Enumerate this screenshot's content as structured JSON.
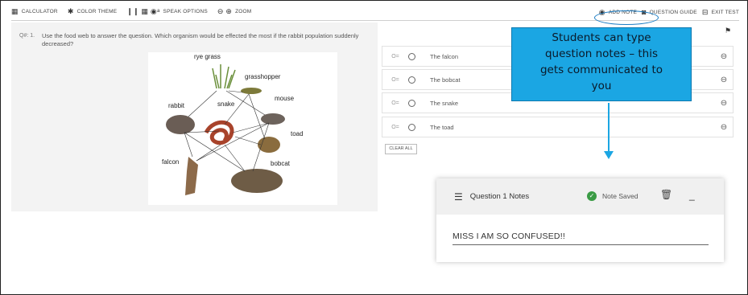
{
  "toolbar": {
    "left": [
      {
        "icon": "calculator-icon",
        "glyph": "▦",
        "label": "CALCULATOR"
      },
      {
        "icon": "palette-icon",
        "glyph": "✱",
        "label": "COLOR THEME"
      },
      {
        "icon": "speak-icon",
        "glyph": "❙❙ ▦ ◉ᵃ",
        "label": "SPEAK OPTIONS"
      },
      {
        "icon": "zoom-icon",
        "glyph": "⊖ ⊕",
        "label": "ZOOM"
      }
    ],
    "right": [
      {
        "icon": "add-note-icon",
        "glyph": "◉",
        "label": "ADD NOTE"
      },
      {
        "icon": "question-guide-icon",
        "glyph": "◙",
        "label": "QUESTION GUIDE"
      },
      {
        "icon": "exit-icon",
        "glyph": "⊟",
        "label": "EXIT TEST"
      }
    ]
  },
  "question": {
    "number": "Q#: 1.",
    "text": "Use the food web to answer the question.  Which organism would be effected the most if the rabbit population suddenly decreased?"
  },
  "foodweb": {
    "labels": [
      "rye grass",
      "grasshopper",
      "rabbit",
      "snake",
      "mouse",
      "toad",
      "falcon",
      "bobcat"
    ]
  },
  "answers": [
    {
      "eliminate": "O=",
      "text": "The falcon",
      "close": "⊖"
    },
    {
      "eliminate": "O=",
      "text": "The bobcat",
      "close": "⊖"
    },
    {
      "eliminate": "O=",
      "text": "The snake",
      "close": "⊖"
    },
    {
      "eliminate": "O=",
      "text": "The toad",
      "close": "⊖"
    }
  ],
  "clear_all": "CLEAR ALL",
  "callout": {
    "lines": [
      "Students can type",
      "question notes – this",
      "gets communicated to",
      "you"
    ],
    "color": "#1ba6e3"
  },
  "notes": {
    "title": "Question 1 Notes",
    "status": "Note Saved",
    "body": "MISS I AM SO CONFUSED!!",
    "minimize": "_"
  }
}
